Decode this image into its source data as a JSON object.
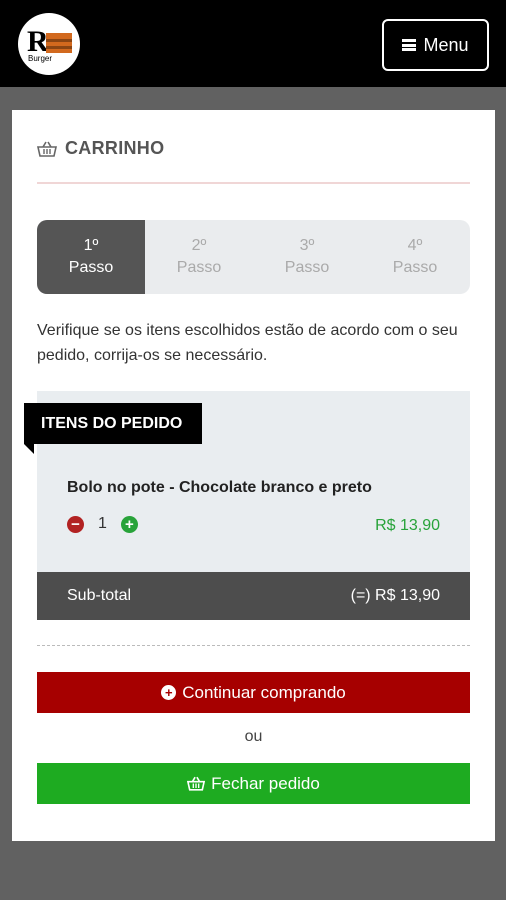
{
  "header": {
    "menu_label": "Menu",
    "logo_icon": "rburger-logo",
    "logo_text": "R Burger"
  },
  "cart": {
    "title": "CARRINHO",
    "steps": [
      {
        "number": "1º",
        "label": "Passo"
      },
      {
        "number": "2º",
        "label": "Passo"
      },
      {
        "number": "3º",
        "label": "Passo"
      },
      {
        "number": "4º",
        "label": "Passo"
      }
    ],
    "instructions": "Verifique se os itens escolhidos estão de acordo com o seu pedido, corrija-os se necessário.",
    "items_heading": "ITENS DO PEDIDO",
    "items": [
      {
        "name": "Bolo no pote - Chocolate branco e preto",
        "quantity": "1",
        "price": "R$ 13,90"
      }
    ],
    "subtotal_label": "Sub-total",
    "subtotal_value": "(=) R$ 13,90",
    "continue_label": "Continuar comprando",
    "or_label": "ou",
    "checkout_label": "Fechar pedido"
  },
  "colors": {
    "header_bg": "#000000",
    "page_bg": "#616161",
    "active_step": "#555555",
    "continue_button": "#a60000",
    "checkout_button": "#1eab21",
    "price_green": "#28a33a",
    "minus_red": "#b22222"
  }
}
